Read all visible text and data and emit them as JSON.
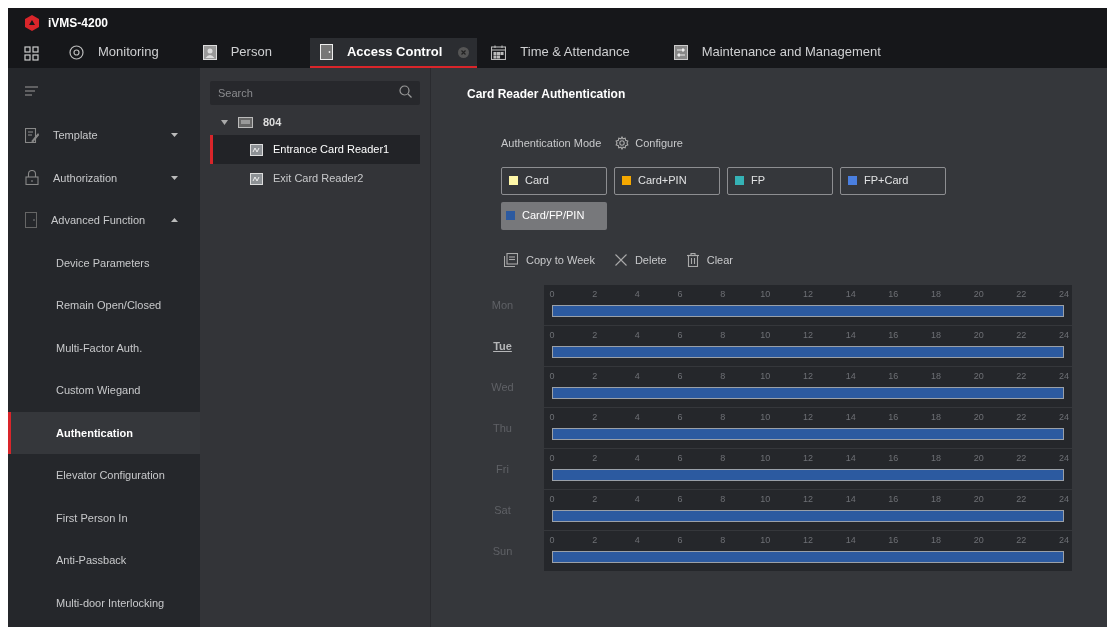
{
  "window": {
    "title": "iVMS-4200"
  },
  "tabs": [
    {
      "label": "Monitoring",
      "selected": false,
      "closable": false
    },
    {
      "label": "Person",
      "selected": false,
      "closable": false
    },
    {
      "label": "Access Control",
      "selected": true,
      "closable": true
    },
    {
      "label": "Time & Attendance",
      "selected": false,
      "closable": false
    },
    {
      "label": "Maintenance and Management",
      "selected": false,
      "closable": false
    }
  ],
  "sidebar": {
    "items": [
      {
        "kind": "group",
        "label": "Template",
        "expanded": false
      },
      {
        "kind": "group",
        "label": "Authorization",
        "expanded": false
      },
      {
        "kind": "group",
        "label": "Advanced Function",
        "expanded": true
      },
      {
        "kind": "sub",
        "label": "Device Parameters",
        "selected": false
      },
      {
        "kind": "sub",
        "label": "Remain Open/Closed",
        "selected": false
      },
      {
        "kind": "sub",
        "label": "Multi-Factor Auth.",
        "selected": false
      },
      {
        "kind": "sub",
        "label": "Custom Wiegand",
        "selected": false
      },
      {
        "kind": "sub",
        "label": "Authentication",
        "selected": true
      },
      {
        "kind": "sub",
        "label": "Elevator Configuration",
        "selected": false
      },
      {
        "kind": "sub",
        "label": "First Person In",
        "selected": false
      },
      {
        "kind": "sub",
        "label": "Anti-Passback",
        "selected": false
      },
      {
        "kind": "sub",
        "label": "Multi-door Interlocking",
        "selected": false
      }
    ]
  },
  "tree": {
    "search": {
      "placeholder": "Search"
    },
    "nodes": [
      {
        "label": "804",
        "expanded": true,
        "children": [
          {
            "label": "Entrance Card Reader1",
            "selected": true
          },
          {
            "label": "Exit Card Reader2",
            "selected": false
          }
        ]
      }
    ]
  },
  "panel": {
    "title": "Card Reader Authentication",
    "mode_label": "Authentication Mode",
    "configure": "Configure",
    "modes": [
      {
        "label": "Card",
        "color": "#fff7a8",
        "selected": false
      },
      {
        "label": "Card+PIN",
        "color": "#f5a800",
        "selected": false
      },
      {
        "label": "FP",
        "color": "#35b2b5",
        "selected": false
      },
      {
        "label": "FP+Card",
        "color": "#4a7fe0",
        "selected": false
      },
      {
        "label": "Card/FP/PIN",
        "color": "#2c5aa0",
        "selected": true
      }
    ],
    "toolbar": [
      "Copy to Week",
      "Delete",
      "Clear"
    ],
    "days": [
      {
        "label": "Mon",
        "selected": false,
        "level": 1,
        "hours": [
          "0",
          "2",
          "4",
          "6",
          "8",
          "10",
          "12",
          "14",
          "16",
          "18",
          "20",
          "22",
          "24"
        ]
      },
      {
        "label": "Tue",
        "selected": true,
        "level": 1,
        "hours": [
          "0",
          "2",
          "4",
          "6",
          "8",
          "10",
          "12",
          "14",
          "16",
          "18",
          "20",
          "22",
          "24"
        ]
      },
      {
        "label": "Wed",
        "selected": false,
        "level": 1,
        "hours": [
          "0",
          "2",
          "4",
          "6",
          "8",
          "10",
          "12",
          "14",
          "16",
          "18",
          "20",
          "22",
          "24"
        ]
      },
      {
        "label": "Thu",
        "selected": false,
        "level": 1,
        "hours": [
          "0",
          "2",
          "4",
          "6",
          "8",
          "10",
          "12",
          "14",
          "16",
          "18",
          "20",
          "22",
          "24"
        ]
      },
      {
        "label": "Fri",
        "selected": false,
        "level": 1,
        "hours": [
          "0",
          "2",
          "4",
          "6",
          "8",
          "10",
          "12",
          "14",
          "16",
          "18",
          "20",
          "22",
          "24"
        ]
      },
      {
        "label": "Sat",
        "selected": false,
        "level": 1,
        "hours": [
          "0",
          "2",
          "4",
          "6",
          "8",
          "10",
          "12",
          "14",
          "16",
          "18",
          "20",
          "22",
          "24"
        ]
      },
      {
        "label": "Sun",
        "selected": false,
        "level": 1,
        "hours": [
          "0",
          "2",
          "4",
          "6",
          "8",
          "10",
          "12",
          "14",
          "16",
          "18",
          "20",
          "22",
          "24"
        ]
      }
    ]
  }
}
